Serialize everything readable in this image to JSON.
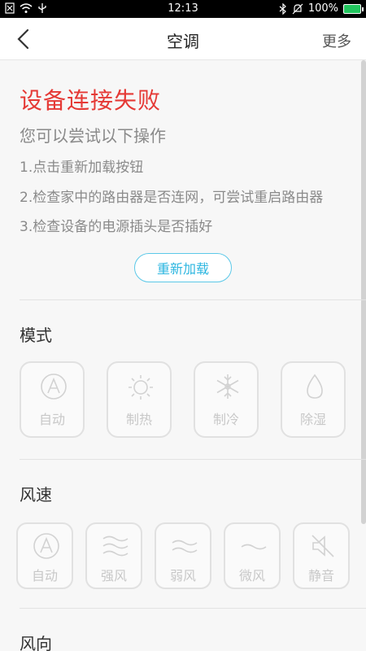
{
  "status_bar": {
    "time": "12:13",
    "battery": "100%"
  },
  "nav": {
    "title": "空调",
    "more": "更多"
  },
  "error": {
    "title": "设备连接失败",
    "subtitle": "您可以尝试以下操作",
    "steps": [
      "1.点击重新加载按钮",
      "2.检查家中的路由器是否连网，可尝试重启路由器",
      "3.检查设备的电源插头是否插好"
    ],
    "reload_label": "重新加载"
  },
  "mode": {
    "label": "模式",
    "items": [
      {
        "label": "自动",
        "icon": "auto-icon"
      },
      {
        "label": "制热",
        "icon": "sun-icon"
      },
      {
        "label": "制冷",
        "icon": "snowflake-icon"
      },
      {
        "label": "除湿",
        "icon": "droplet-icon"
      }
    ]
  },
  "fan": {
    "label": "风速",
    "items": [
      {
        "label": "自动",
        "icon": "auto-icon"
      },
      {
        "label": "强风",
        "icon": "wind-strong-icon"
      },
      {
        "label": "弱风",
        "icon": "wind-weak-icon"
      },
      {
        "label": "微风",
        "icon": "wind-breeze-icon"
      },
      {
        "label": "静音",
        "icon": "mute-icon"
      }
    ]
  },
  "direction": {
    "label": "风向"
  },
  "colors": {
    "error": "#e53935",
    "accent": "#2cb6e0",
    "disabled": "#c8c8c8"
  }
}
